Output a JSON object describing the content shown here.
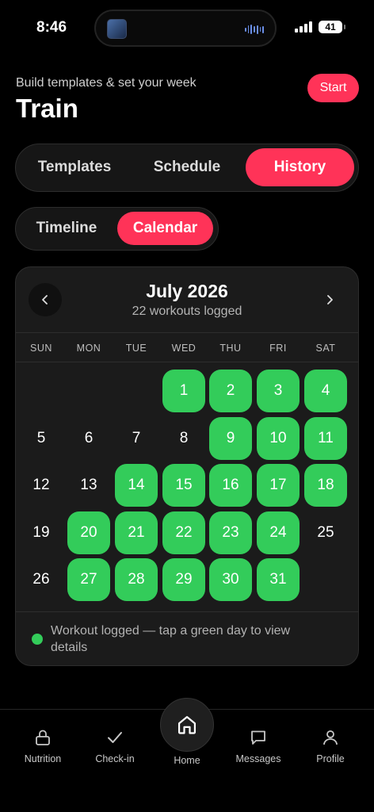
{
  "status_bar": {
    "time": "8:46",
    "battery": "41"
  },
  "header": {
    "subtitle": "Build templates & set your week",
    "title": "Train",
    "start_label": "Start"
  },
  "main_tabs": [
    {
      "label": "Templates",
      "active": false
    },
    {
      "label": "Schedule",
      "active": false
    },
    {
      "label": "History",
      "active": true
    }
  ],
  "view_tabs": [
    {
      "label": "Timeline",
      "active": false
    },
    {
      "label": "Calendar",
      "active": true
    }
  ],
  "calendar": {
    "month_label": "July 2026",
    "workouts_logged": "22 workouts logged",
    "prev_icon": "chevron-left-icon",
    "next_icon": "chevron-right-icon",
    "weekdays": [
      "SUN",
      "MON",
      "TUE",
      "WED",
      "THU",
      "FRI",
      "SAT"
    ],
    "first_weekday_index": 3,
    "days": [
      {
        "n": "1",
        "logged": true
      },
      {
        "n": "2",
        "logged": true
      },
      {
        "n": "3",
        "logged": true
      },
      {
        "n": "4",
        "logged": true
      },
      {
        "n": "5",
        "logged": false
      },
      {
        "n": "6",
        "logged": false
      },
      {
        "n": "7",
        "logged": false
      },
      {
        "n": "8",
        "logged": false
      },
      {
        "n": "9",
        "logged": true
      },
      {
        "n": "10",
        "logged": true
      },
      {
        "n": "11",
        "logged": true
      },
      {
        "n": "12",
        "logged": false
      },
      {
        "n": "13",
        "logged": false
      },
      {
        "n": "14",
        "logged": true
      },
      {
        "n": "15",
        "logged": true
      },
      {
        "n": "16",
        "logged": true
      },
      {
        "n": "17",
        "logged": true
      },
      {
        "n": "18",
        "logged": true
      },
      {
        "n": "19",
        "logged": false
      },
      {
        "n": "20",
        "logged": true
      },
      {
        "n": "21",
        "logged": true
      },
      {
        "n": "22",
        "logged": true
      },
      {
        "n": "23",
        "logged": true
      },
      {
        "n": "24",
        "logged": true
      },
      {
        "n": "25",
        "logged": false
      },
      {
        "n": "26",
        "logged": false
      },
      {
        "n": "27",
        "logged": true
      },
      {
        "n": "28",
        "logged": true
      },
      {
        "n": "29",
        "logged": true
      },
      {
        "n": "30",
        "logged": true
      },
      {
        "n": "31",
        "logged": true
      }
    ],
    "legend": "Workout logged — tap a green day to view details"
  },
  "bottom_nav": {
    "items": [
      {
        "label": "Nutrition",
        "icon": "lock-icon"
      },
      {
        "label": "Check-in",
        "icon": "checkmark-icon"
      },
      {
        "label": "Home",
        "icon": "home-icon"
      },
      {
        "label": "Messages",
        "icon": "chat-bubble-icon"
      },
      {
        "label": "Profile",
        "icon": "person-icon"
      }
    ]
  },
  "colors": {
    "accent": "#ff3358",
    "logged_green": "#33cc5a",
    "background": "#000000",
    "card": "#1b1b1b"
  }
}
